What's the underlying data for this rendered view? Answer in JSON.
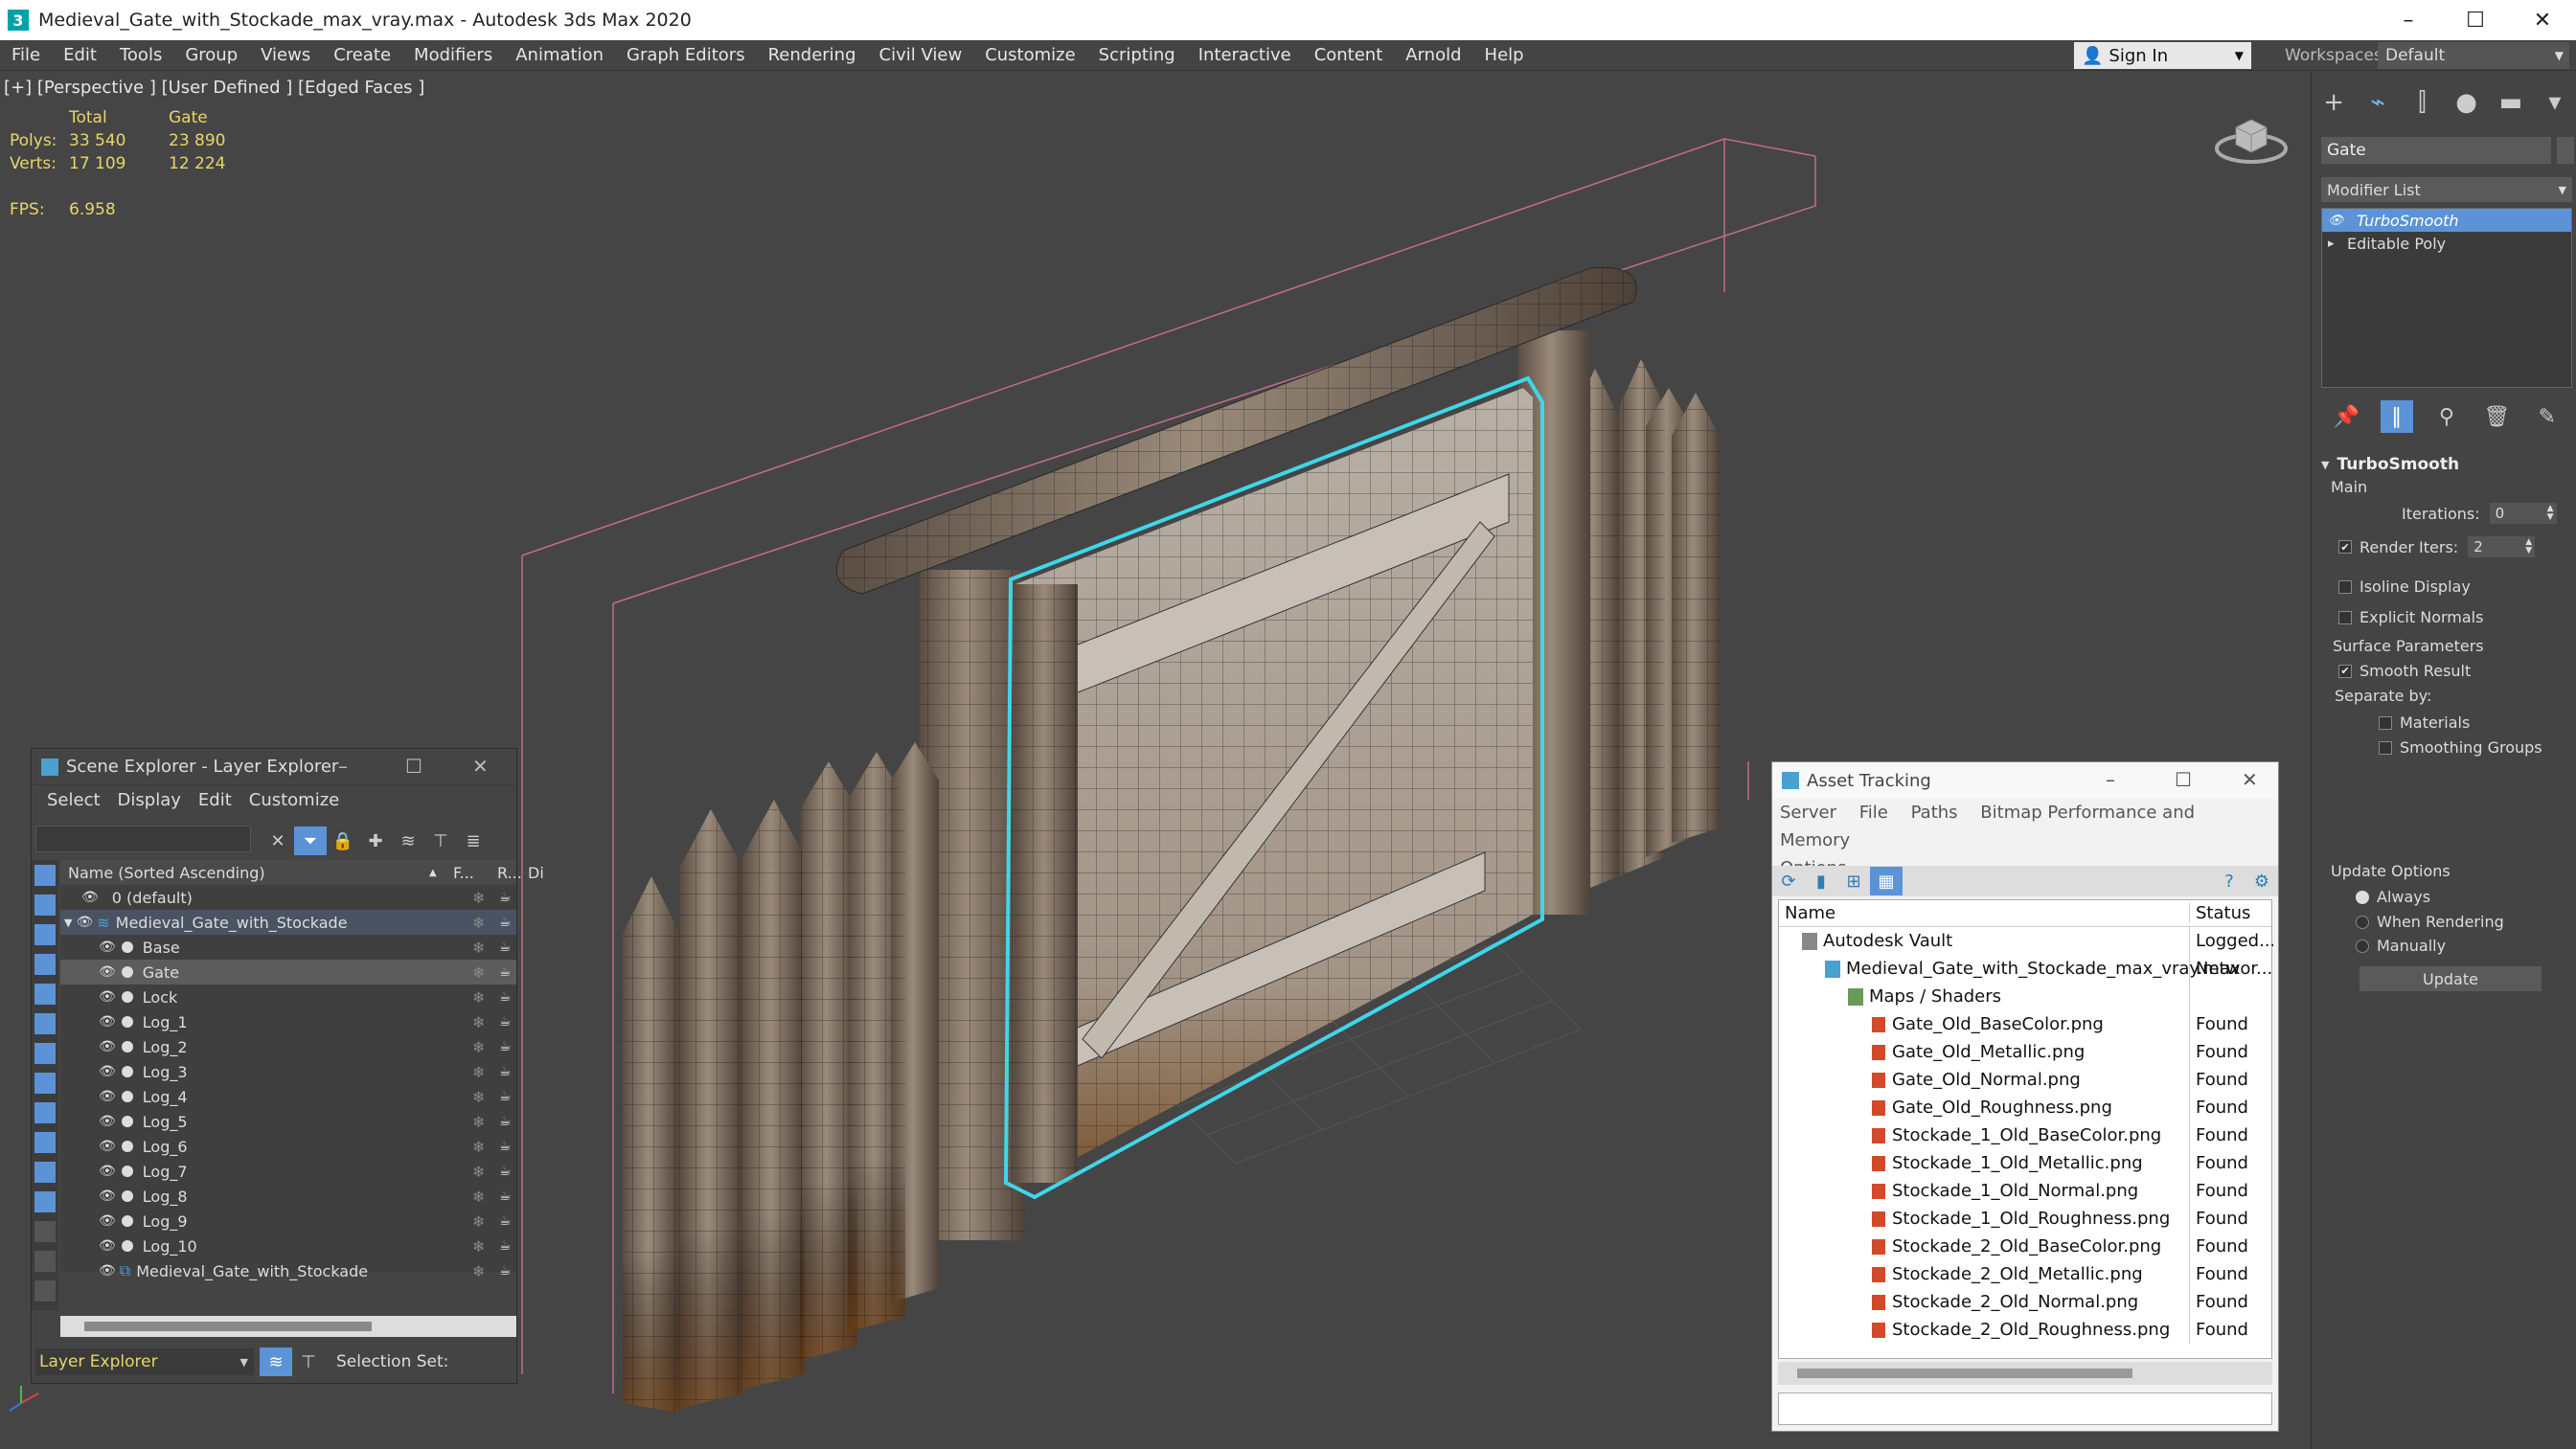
{
  "window": {
    "title": "Medieval_Gate_with_Stockade_max_vray.max - Autodesk 3ds Max 2020",
    "app_icon": "3"
  },
  "menu": [
    "File",
    "Edit",
    "Tools",
    "Group",
    "Views",
    "Create",
    "Modifiers",
    "Animation",
    "Graph Editors",
    "Rendering",
    "Civil View",
    "Customize",
    "Scripting",
    "Interactive",
    "Content",
    "Arnold",
    "Help"
  ],
  "signin": "Sign In",
  "workspaces": {
    "label": "Workspaces:",
    "value": "Default"
  },
  "viewport": {
    "label": "[+] [Perspective ] [User Defined ] [Edged Faces ]",
    "stats": {
      "total_label": "Total",
      "gate_label": "Gate",
      "polys_label": "Polys:",
      "verts_label": "Verts:",
      "polys_total": "33 540",
      "polys_gate": "23 890",
      "verts_total": "17 109",
      "verts_gate": "12 224",
      "fps_label": "FPS:",
      "fps_value": "6.958"
    }
  },
  "command_panel": {
    "object_name": "Gate",
    "modifier_list": "Modifier List",
    "stack": [
      "TurboSmooth",
      "Editable Poly"
    ],
    "rollout": {
      "title": "TurboSmooth",
      "main": "Main",
      "iterations_label": "Iterations:",
      "iterations_value": "0",
      "render_iters_label": "Render Iters:",
      "render_iters_value": "2",
      "isoline": "Isoline Display",
      "explicit_normals": "Explicit Normals",
      "surface_params": "Surface Parameters",
      "smooth_result": "Smooth Result",
      "separate_by": "Separate by:",
      "materials": "Materials",
      "smoothing_groups": "Smoothing Groups",
      "update_options": "Update Options",
      "always": "Always",
      "when_rendering": "When Rendering",
      "manually": "Manually",
      "update_button": "Update"
    }
  },
  "scene_explorer": {
    "title": "Scene Explorer - Layer Explorer",
    "menu": [
      "Select",
      "Display",
      "Edit",
      "Customize"
    ],
    "columns": {
      "name": "Name (Sorted Ascending)",
      "f": "F...",
      "r": "R...",
      "d": "Di"
    },
    "rows": [
      {
        "name": "0 (default)"
      },
      {
        "name": "Medieval_Gate_with_Stockade"
      },
      {
        "name": "Base"
      },
      {
        "name": "Gate"
      },
      {
        "name": "Lock"
      },
      {
        "name": "Log_1"
      },
      {
        "name": "Log_2"
      },
      {
        "name": "Log_3"
      },
      {
        "name": "Log_4"
      },
      {
        "name": "Log_5"
      },
      {
        "name": "Log_6"
      },
      {
        "name": "Log_7"
      },
      {
        "name": "Log_8"
      },
      {
        "name": "Log_9"
      },
      {
        "name": "Log_10"
      },
      {
        "name": "Medieval_Gate_with_Stockade"
      }
    ],
    "footer_layer": "Layer Explorer",
    "selection_set": "Selection Set:"
  },
  "asset_tracking": {
    "title": "Asset Tracking",
    "menu": [
      "Server",
      "File",
      "Paths",
      "Bitmap Performance and Memory",
      "Options"
    ],
    "columns": {
      "name": "Name",
      "status": "Status"
    },
    "rows": [
      {
        "name": "Autodesk Vault",
        "status": "Logged..."
      },
      {
        "name": "Medieval_Gate_with_Stockade_max_vray.max",
        "status": "Networ..."
      },
      {
        "name": "Maps / Shaders",
        "status": ""
      },
      {
        "name": "Gate_Old_BaseColor.png",
        "status": "Found"
      },
      {
        "name": "Gate_Old_Metallic.png",
        "status": "Found"
      },
      {
        "name": "Gate_Old_Normal.png",
        "status": "Found"
      },
      {
        "name": "Gate_Old_Roughness.png",
        "status": "Found"
      },
      {
        "name": "Stockade_1_Old_BaseColor.png",
        "status": "Found"
      },
      {
        "name": "Stockade_1_Old_Metallic.png",
        "status": "Found"
      },
      {
        "name": "Stockade_1_Old_Normal.png",
        "status": "Found"
      },
      {
        "name": "Stockade_1_Old_Roughness.png",
        "status": "Found"
      },
      {
        "name": "Stockade_2_Old_BaseColor.png",
        "status": "Found"
      },
      {
        "name": "Stockade_2_Old_Metallic.png",
        "status": "Found"
      },
      {
        "name": "Stockade_2_Old_Normal.png",
        "status": "Found"
      },
      {
        "name": "Stockade_2_Old_Roughness.png",
        "status": "Found"
      }
    ]
  },
  "colors": {
    "accent": "#5b93d6",
    "stats": "#e7d66a",
    "selection_outline": "#3fd6ea"
  }
}
